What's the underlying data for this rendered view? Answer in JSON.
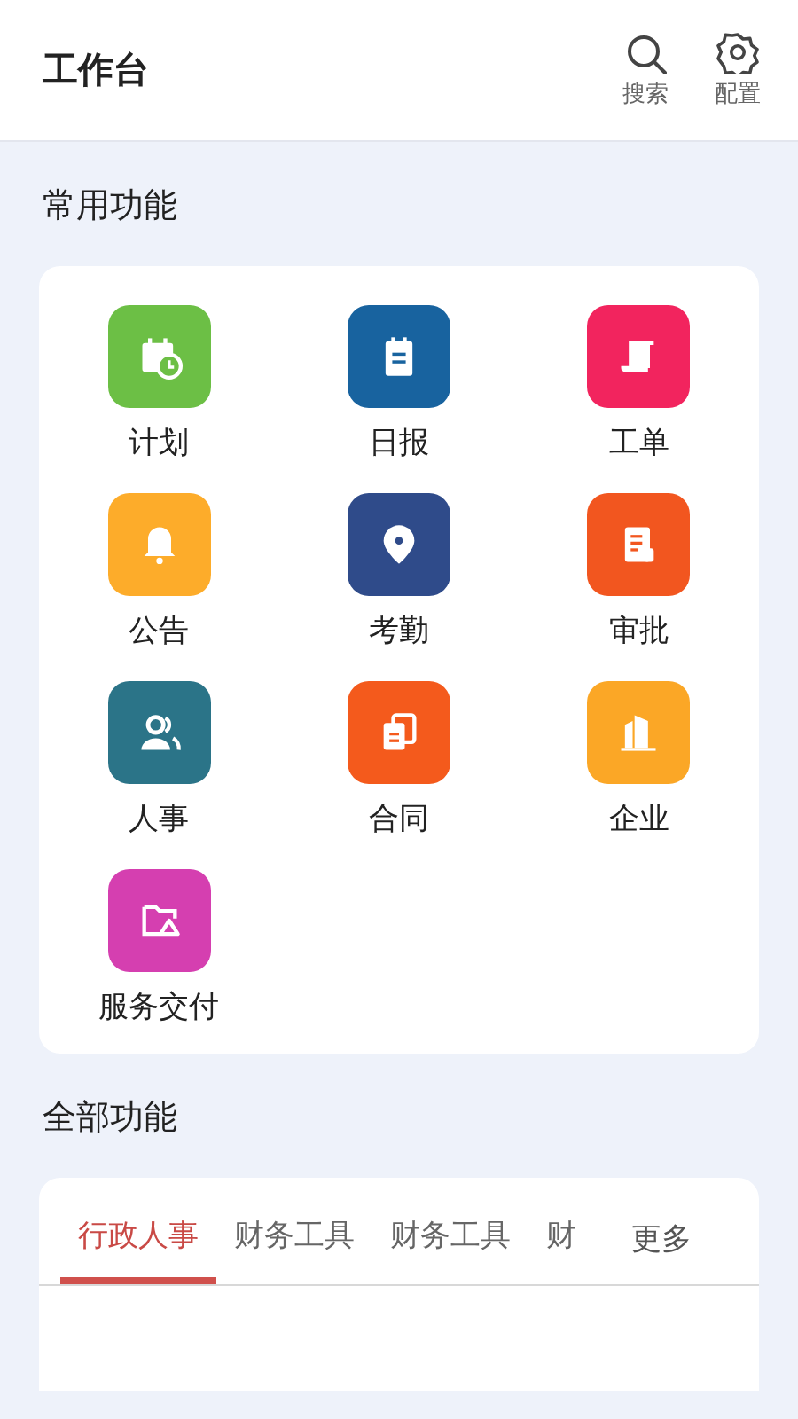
{
  "header": {
    "title": "工作台",
    "actions": [
      {
        "kind": "search",
        "label": "搜索"
      },
      {
        "kind": "settings",
        "label": "配置"
      }
    ]
  },
  "common": {
    "title": "常用功能",
    "items": [
      {
        "label": "计划",
        "kind": "calendar",
        "color": "#6cbf45"
      },
      {
        "label": "日报",
        "kind": "notepad",
        "color": "#18639f"
      },
      {
        "label": "工单",
        "kind": "scroll",
        "color": "#f2245e"
      },
      {
        "label": "公告",
        "kind": "bell",
        "color": "#fdac2a"
      },
      {
        "label": "考勤",
        "kind": "pin",
        "color": "#2f4b8a"
      },
      {
        "label": "审批",
        "kind": "document",
        "color": "#f2561f"
      },
      {
        "label": "人事",
        "kind": "people",
        "color": "#2b7488"
      },
      {
        "label": "合同",
        "kind": "copy",
        "color": "#f45a1c"
      },
      {
        "label": "企业",
        "kind": "building",
        "color": "#fba726"
      },
      {
        "label": "服务交付",
        "kind": "folder",
        "color": "#d53fb0"
      }
    ]
  },
  "all": {
    "title": "全部功能",
    "tabs": [
      {
        "label": "行政人事",
        "selected": true
      },
      {
        "label": "财务工具",
        "selected": false
      },
      {
        "label": "财务工具",
        "selected": false
      },
      {
        "label": "财",
        "selected": false
      }
    ],
    "more": "更多"
  }
}
